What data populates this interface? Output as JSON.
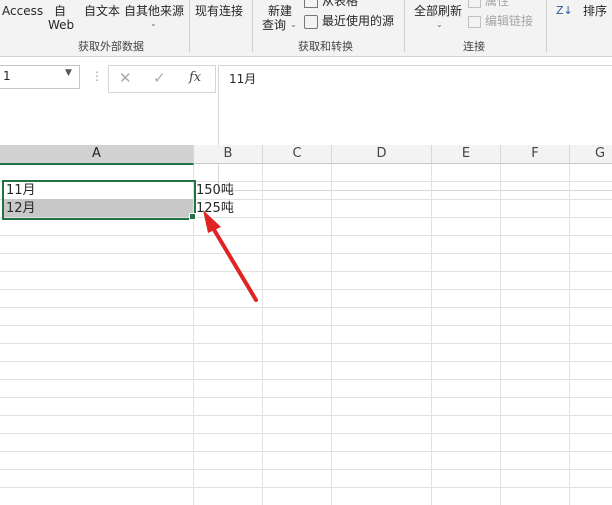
{
  "ribbon": {
    "groups": [
      {
        "label": "获取外部数据"
      },
      {
        "label": "获取和转换"
      },
      {
        "label": "连接"
      }
    ],
    "buttons": {
      "access": "Access",
      "web_top": "自",
      "web_bottom": "Web",
      "text": "自文本",
      "other": "自其他来源",
      "existing": "现有连接",
      "new_query_top": "新建",
      "new_query_bottom": "查询",
      "from_table": "从表格",
      "recent_sources": "最近使用的源",
      "refresh_all": "全部刷新",
      "properties": "属性",
      "edit_links": "编辑链接",
      "sort": "排序"
    }
  },
  "formula_bar": {
    "name_box": "1",
    "content": "11月"
  },
  "grid": {
    "columns": [
      "A",
      "B",
      "C",
      "D",
      "E",
      "F",
      "G"
    ],
    "selected_column": "A",
    "rows": [
      {
        "a": "11月",
        "b": "150吨"
      },
      {
        "a": "12月",
        "b": "125吨"
      }
    ]
  },
  "colors": {
    "accent_green": "#217346",
    "arrow_red": "#e02424",
    "selection_fill": "#c8c8c8"
  }
}
